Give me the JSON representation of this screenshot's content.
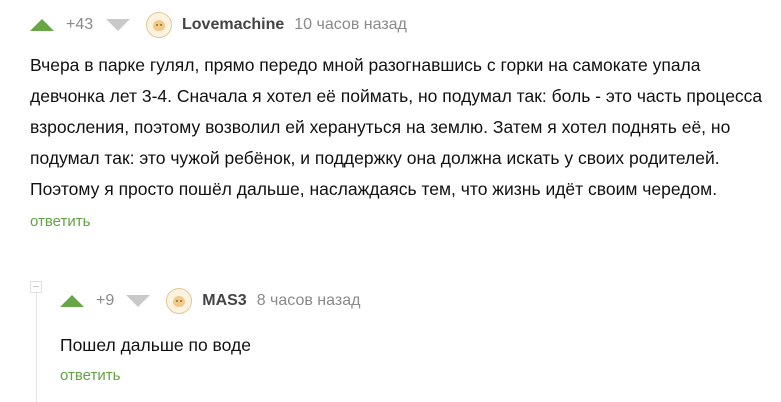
{
  "colors": {
    "upvote": "#66a644",
    "downvote": "#c9c9c9",
    "reply_link": "#62a443",
    "meta_text": "#8a8a8a"
  },
  "comments": [
    {
      "rating": "+43",
      "author": "Lovemachine",
      "time": "10 часов назад",
      "text": "Вчера в парке гулял, прямо передо мной разогнавшись с горки на самокате упала девчонка лет 3-4. Сначала я хотел её поймать, но подумал так: боль - это часть процесса взросления, поэтому возволил ей херануться на землю. Затем я хотел поднять её, но подумал так: это чужой ребёнок, и поддержку она должна искать у своих родителей. Поэтому я просто пошёл дальше, наслаждаясь тем, что жизнь идёт своим чередом.",
      "reply_label": "ответить",
      "icons": {
        "upvote": "arrow-up-icon",
        "downvote": "arrow-down-icon",
        "avatar": "avatar-icon"
      }
    },
    {
      "rating": "+9",
      "author": "MAS3",
      "time": "8 часов назад",
      "text": "Пошел дальше по воде",
      "reply_label": "ответить",
      "icons": {
        "upvote": "arrow-up-icon",
        "downvote": "arrow-down-icon",
        "avatar": "avatar-icon"
      }
    }
  ],
  "thread": {
    "toggle_icon": "collapse-thread-icon"
  }
}
